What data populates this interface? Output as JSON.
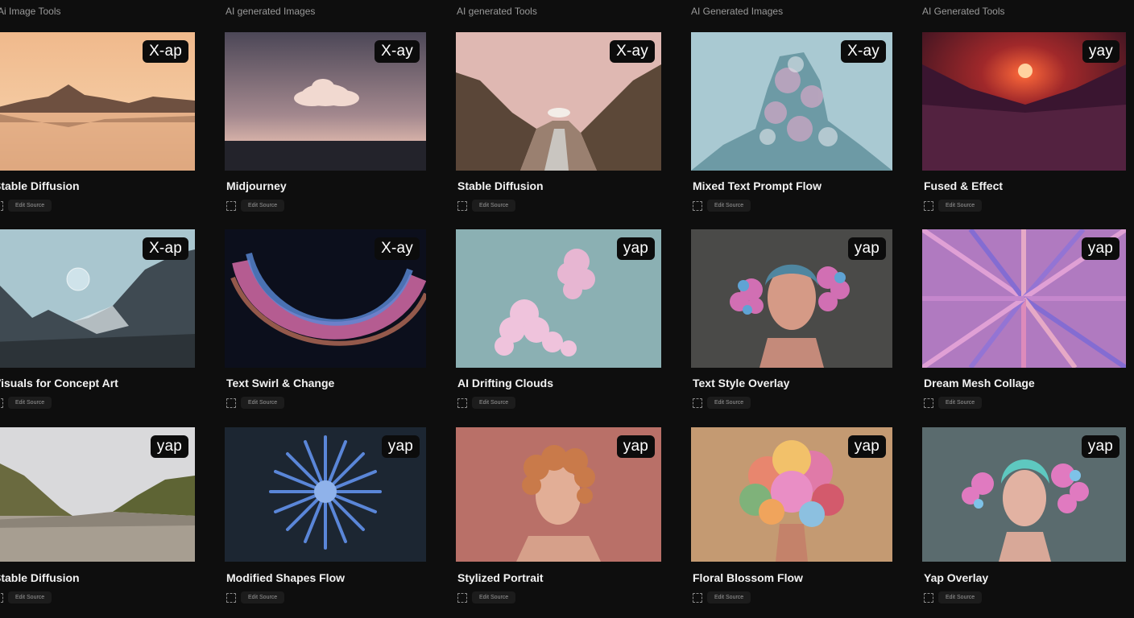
{
  "column_headers": [
    "Ai Image Tools",
    "AI generated Images",
    "AI generated Tools",
    "AI Generated Images",
    "AI Generated Tools"
  ],
  "meta_chip_label": "Edit Source",
  "cards": [
    {
      "title": "Stable Diffusion",
      "badge": "X-ap"
    },
    {
      "title": "Midjourney",
      "badge": "X-ay"
    },
    {
      "title": "Stable Diffusion",
      "badge": "X-ay"
    },
    {
      "title": "Mixed Text Prompt Flow",
      "badge": "X-ay"
    },
    {
      "title": "Fused & Effect",
      "badge": "yay"
    },
    {
      "title": "Visuals for Concept Art",
      "badge": "X-ap"
    },
    {
      "title": "Text Swirl & Change",
      "badge": "X-ay"
    },
    {
      "title": "AI Drifting Clouds",
      "badge": "yap"
    },
    {
      "title": "Text Style Overlay",
      "badge": "yap"
    },
    {
      "title": "Dream Mesh Collage",
      "badge": "yap"
    },
    {
      "title": "Stable Diffusion",
      "badge": "yap"
    },
    {
      "title": "Modified Shapes Flow",
      "badge": "yap"
    },
    {
      "title": "Stylized Portrait",
      "badge": "yap"
    },
    {
      "title": "Floral Blossom Flow",
      "badge": "yap"
    },
    {
      "title": "Yap Overlay",
      "badge": "yap"
    }
  ]
}
